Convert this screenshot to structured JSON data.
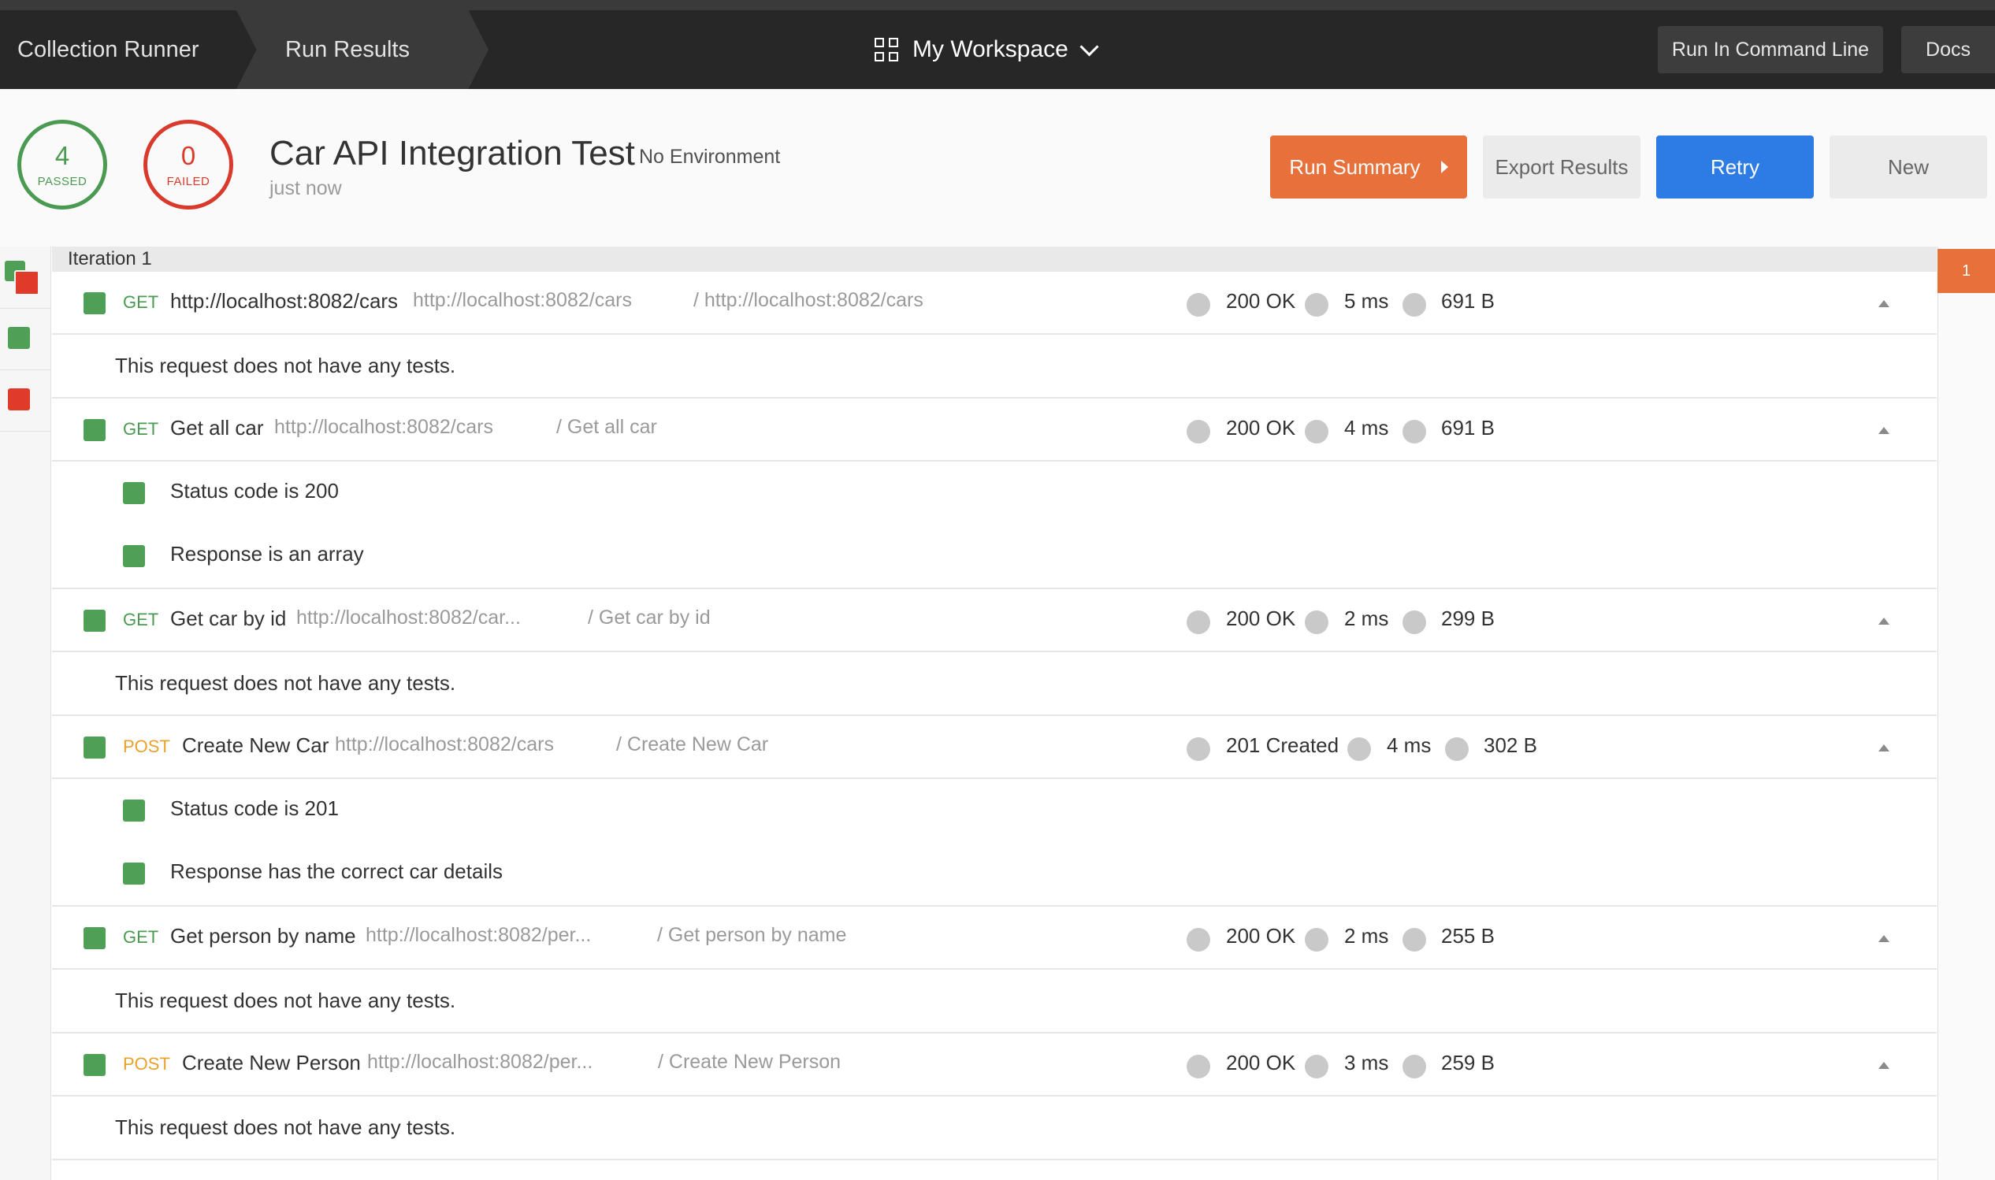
{
  "topbar": {
    "breadcrumb": [
      "Collection Runner",
      "Run Results"
    ],
    "workspace": "My Workspace",
    "run_cli_label": "Run In Command Line",
    "docs_label": "Docs"
  },
  "summary": {
    "passed_count": "4",
    "passed_label": "PASSED",
    "failed_count": "0",
    "failed_label": "FAILED",
    "title": "Car API Integration Test",
    "environment": "No Environment",
    "time": "just now",
    "run_summary_label": "Run Summary",
    "export_label": "Export Results",
    "retry_label": "Retry",
    "new_label": "New"
  },
  "iteration_label": "Iteration 1",
  "iteration_badge": "1",
  "colors": {
    "pass": "#4f9f56",
    "fail": "#e03a2a",
    "accent": "#e8703a",
    "primary": "#2d7be5"
  },
  "requests": [
    {
      "method": "GET",
      "name": "http://localhost:8082/cars",
      "url": "http://localhost:8082/cars",
      "path": "/ http://localhost:8082/cars",
      "status": "200 OK",
      "time": "5 ms",
      "size": "691 B",
      "note": "This request does not have any tests.",
      "tests": []
    },
    {
      "method": "GET",
      "name": "Get all car",
      "url": "http://localhost:8082/cars",
      "path": "/ Get all car",
      "status": "200 OK",
      "time": "4 ms",
      "size": "691 B",
      "note": null,
      "tests": [
        "Status code is 200",
        "Response is an array"
      ]
    },
    {
      "method": "GET",
      "name": "Get car by id",
      "url": "http://localhost:8082/car...",
      "path": "/ Get car by id",
      "status": "200 OK",
      "time": "2 ms",
      "size": "299 B",
      "note": "This request does not have any tests.",
      "tests": []
    },
    {
      "method": "POST",
      "name": "Create New Car",
      "url": "http://localhost:8082/cars",
      "path": "/ Create New Car",
      "status": "201 Created",
      "time": "4 ms",
      "size": "302 B",
      "note": null,
      "tests": [
        "Status code is 201",
        "Response has the correct car details"
      ]
    },
    {
      "method": "GET",
      "name": "Get person by name",
      "url": "http://localhost:8082/per...",
      "path": "/ Get person by name",
      "status": "200 OK",
      "time": "2 ms",
      "size": "255 B",
      "note": "This request does not have any tests.",
      "tests": []
    },
    {
      "method": "POST",
      "name": "Create New Person",
      "url": "http://localhost:8082/per...",
      "path": "/ Create New Person",
      "status": "200 OK",
      "time": "3 ms",
      "size": "259 B",
      "note": "This request does not have any tests.",
      "tests": []
    }
  ]
}
